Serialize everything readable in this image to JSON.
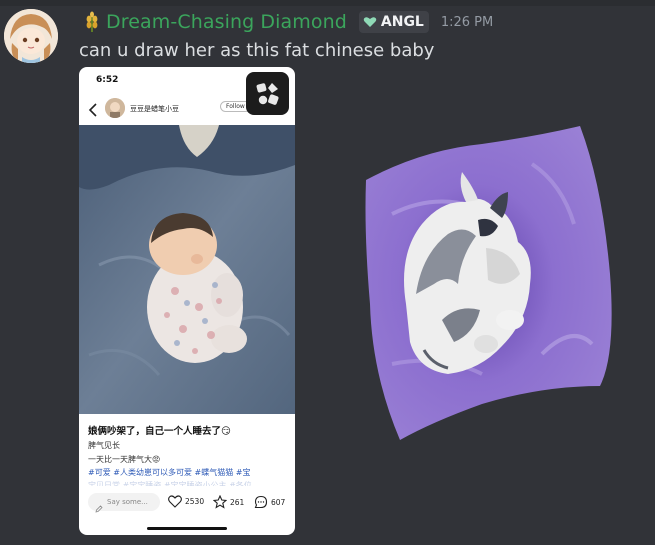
{
  "message": {
    "author": "Dream-Chasing Diamond",
    "role_tag": "ANGL",
    "timestamp": "1:26 PM",
    "text": "can u draw her as this fat chinese baby"
  },
  "phone_screenshot": {
    "status_time": "6:52",
    "author_name": "豆豆是蜡笔小豆",
    "follow_label": "Follow",
    "title": "娘俩吵架了，自己一个人睡去了😏",
    "line1": "脾气见长",
    "line2": "一天比一天脾气大😡",
    "tags": "#可爱 #人类幼崽可以多可爱 #蝶气猫猫 #宝",
    "tags_overflow": "宝贝日常 #宝宝睡姿 #宝宝睡姿小公主 #各位",
    "comment_placeholder": "Say some...",
    "likes": "2530",
    "stars": "261",
    "comments": "607"
  },
  "colors": {
    "background": "#313338",
    "username": "#3ba55c",
    "tag_text": "#2f5bb7",
    "artwork_purple": "#8a6cc8"
  }
}
